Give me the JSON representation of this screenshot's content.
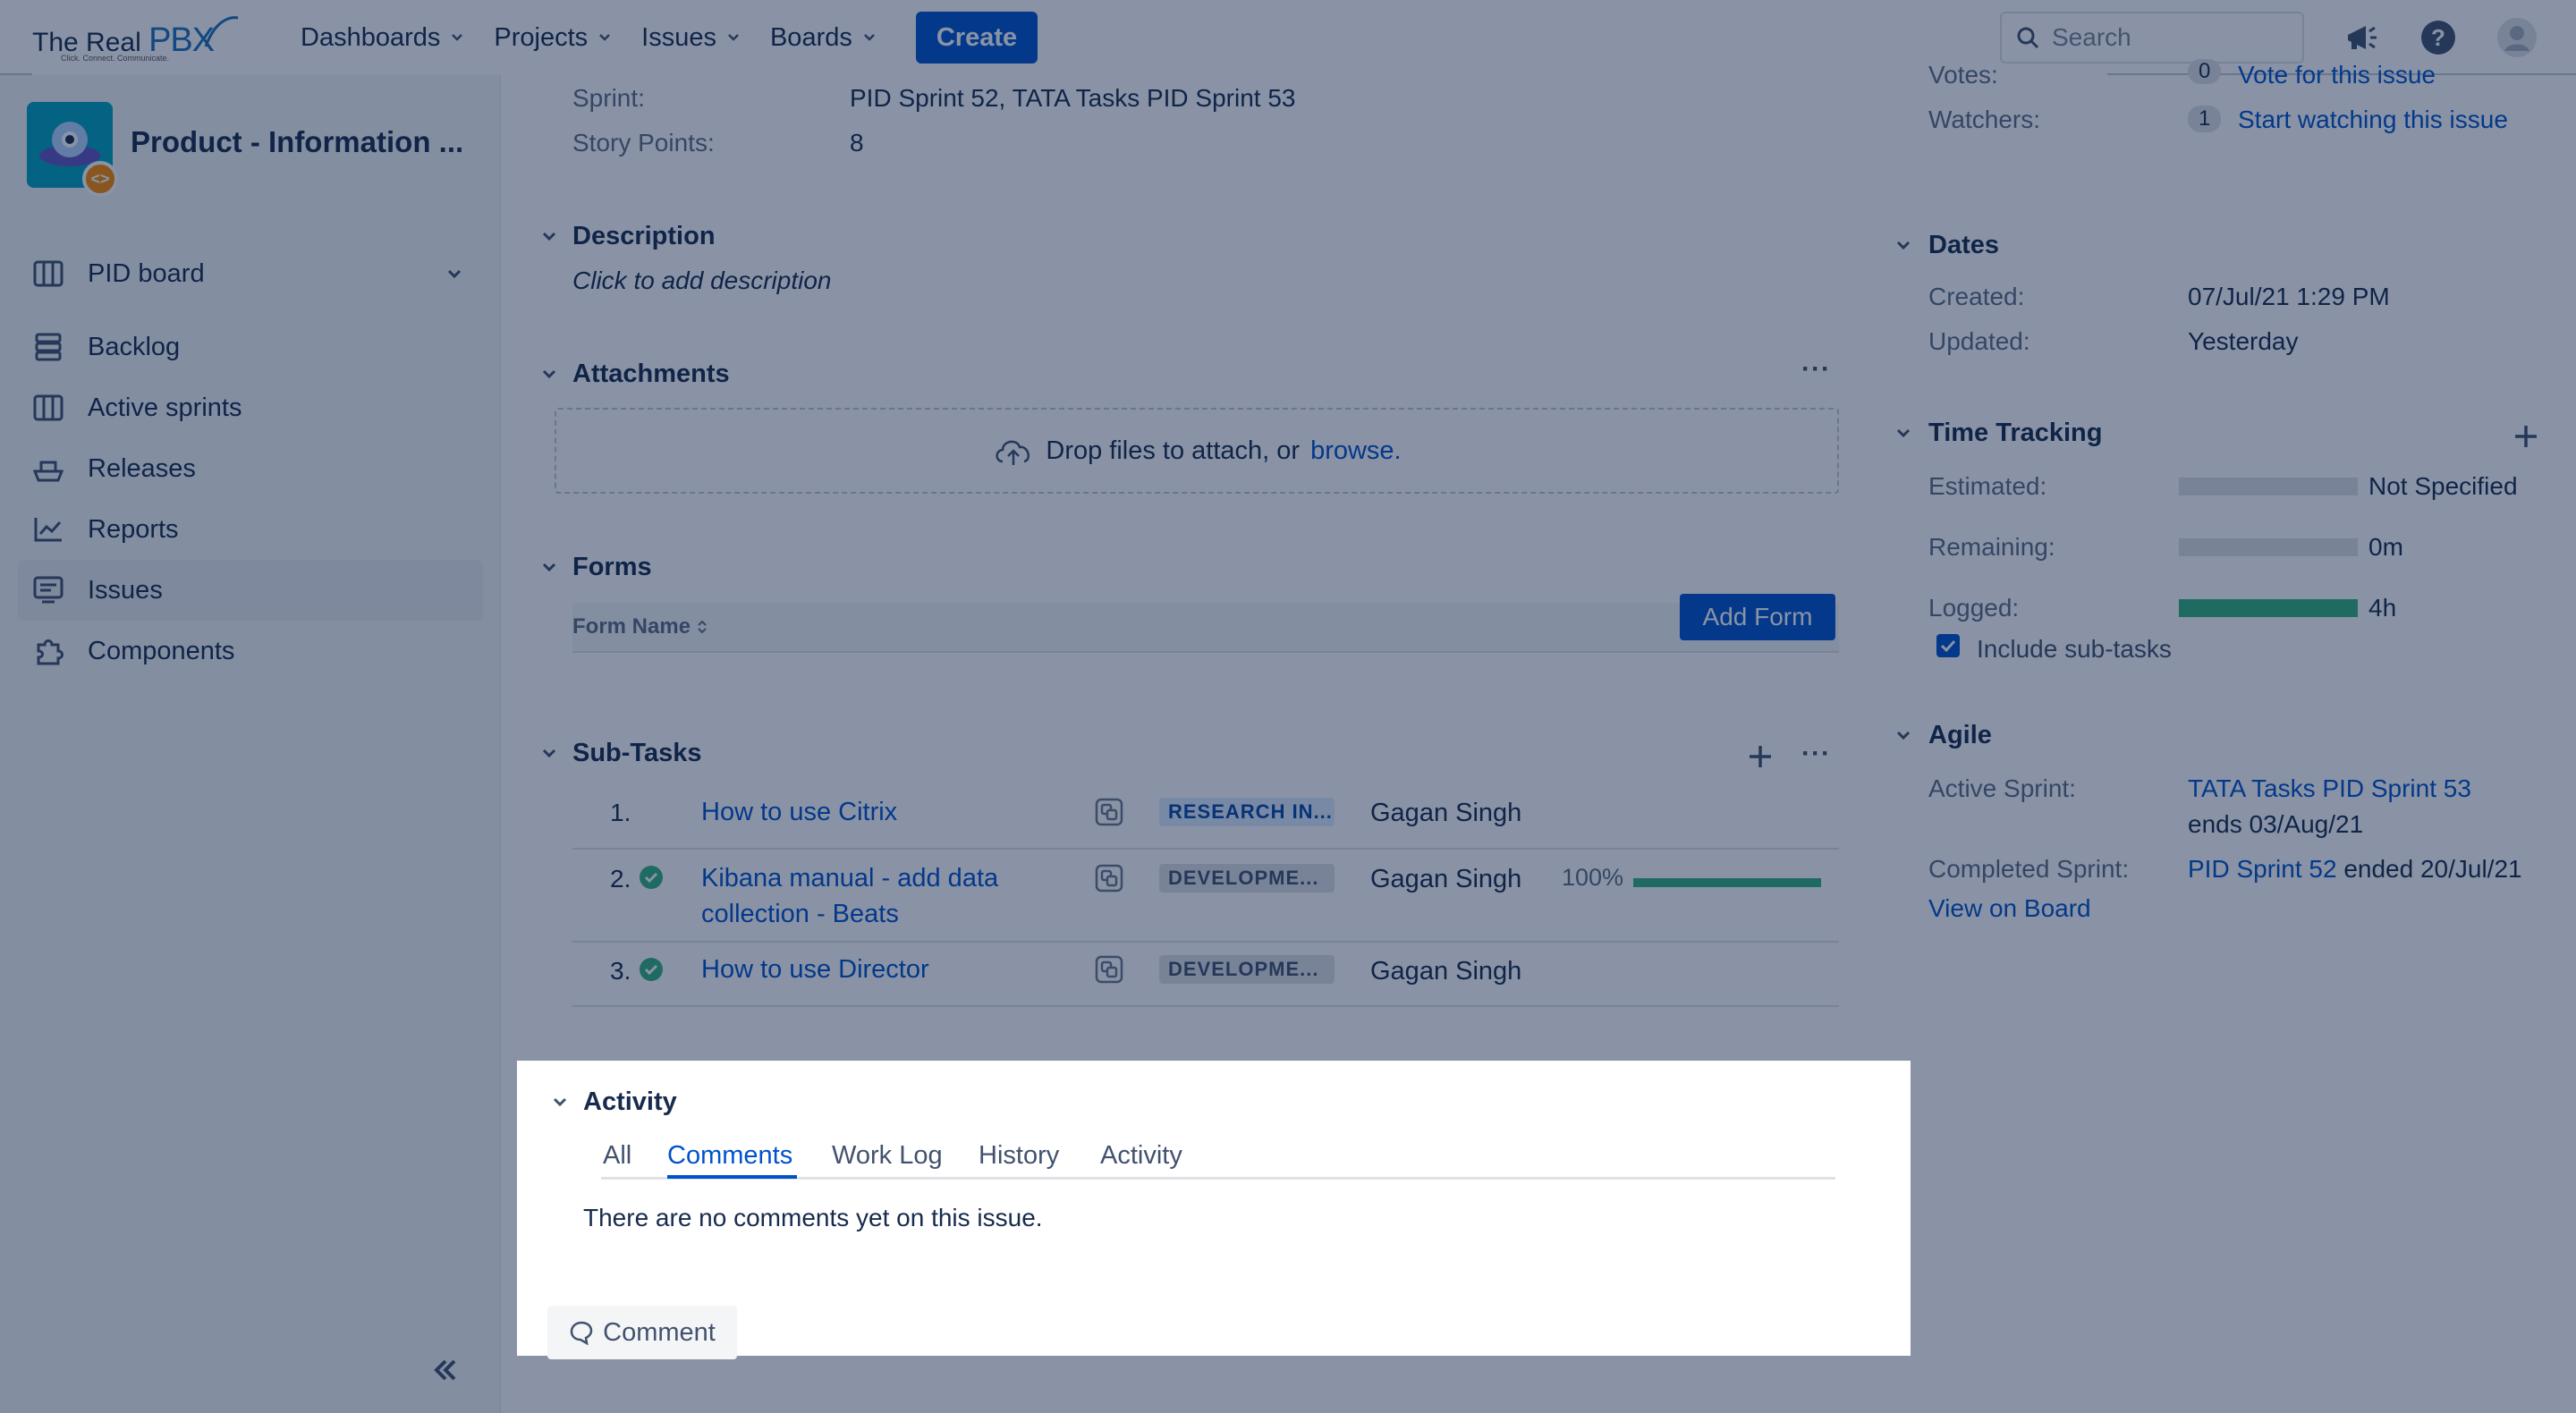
{
  "app": {
    "logo_text": "The Real",
    "logo_brand": "PBX",
    "logo_tagline": "Click. Connect. Communicate.",
    "nav": [
      {
        "label": "Dashboards"
      },
      {
        "label": "Projects"
      },
      {
        "label": "Issues"
      },
      {
        "label": "Boards"
      }
    ],
    "create_label": "Create",
    "search_placeholder": "Search"
  },
  "sidebar": {
    "project_name": "Product - Information ...",
    "items": [
      {
        "label": "PID board",
        "icon": "board-icon"
      },
      {
        "label": "Backlog",
        "icon": "backlog-icon"
      },
      {
        "label": "Active sprints",
        "icon": "sprint-icon"
      },
      {
        "label": "Releases",
        "icon": "ship-icon"
      },
      {
        "label": "Reports",
        "icon": "chart-icon"
      },
      {
        "label": "Issues",
        "icon": "issues-icon"
      },
      {
        "label": "Components",
        "icon": "puzzle-icon"
      }
    ]
  },
  "details": {
    "sprint_label": "Sprint:",
    "sprint_value": "PID Sprint 52, TATA Tasks PID Sprint 53",
    "story_points_label": "Story Points:",
    "story_points_value": "8"
  },
  "description": {
    "title": "Description",
    "placeholder": "Click to add description"
  },
  "attachments": {
    "title": "Attachments",
    "drop_text": "Drop files to attach, or",
    "browse_link": "browse."
  },
  "forms": {
    "title": "Forms",
    "column_header": "Form Name",
    "add_label": "Add Form"
  },
  "subtasks": {
    "title": "Sub-Tasks",
    "rows": [
      {
        "num": "1.",
        "done": false,
        "summary_line1": "How to use Citrix",
        "summary_line2": "",
        "status": "RESEARCH IN...",
        "assignee": "Gagan Singh",
        "progress_label": "",
        "progress": 0
      },
      {
        "num": "2.",
        "done": true,
        "summary_line1": "Kibana manual - add data",
        "summary_line2": "collection - Beats",
        "status": "DEVELOPME...",
        "assignee": "Gagan Singh",
        "progress_label": "100%",
        "progress": 1.0
      },
      {
        "num": "3.",
        "done": true,
        "summary_line1": "How to use Director",
        "summary_line2": "",
        "status": "DEVELOPME...",
        "assignee": "Gagan Singh",
        "progress_label": "",
        "progress": 0
      }
    ]
  },
  "activity": {
    "title": "Activity",
    "tabs": [
      {
        "label": "All"
      },
      {
        "label": "Comments"
      },
      {
        "label": "Work Log"
      },
      {
        "label": "History"
      },
      {
        "label": "Activity"
      }
    ],
    "active_tab": "Comments",
    "empty_text": "There are no comments yet on this issue.",
    "comment_button": "Comment"
  },
  "people": {
    "votes_label": "Votes:",
    "votes_count": "0",
    "vote_link": "Vote for this issue",
    "watchers_label": "Watchers:",
    "watchers_count": "1",
    "watch_link": "Start watching this issue"
  },
  "dates": {
    "title": "Dates",
    "created_label": "Created:",
    "created_value": "07/Jul/21 1:29 PM",
    "updated_label": "Updated:",
    "updated_value": "Yesterday"
  },
  "time_tracking": {
    "title": "Time Tracking",
    "estimated_label": "Estimated:",
    "estimated_value": "Not Specified",
    "estimated_fill": 0,
    "remaining_label": "Remaining:",
    "remaining_value": "0m",
    "remaining_fill": 0,
    "logged_label": "Logged:",
    "logged_value": "4h",
    "logged_fill": 1.0,
    "include_subtasks_label": "Include sub-tasks",
    "include_subtasks_checked": true
  },
  "agile": {
    "title": "Agile",
    "active_sprint_label": "Active Sprint:",
    "active_sprint_link": "TATA Tasks PID Sprint 53",
    "active_sprint_ends": "ends 03/Aug/21",
    "completed_sprint_label": "Completed Sprint:",
    "completed_sprint_link": "PID Sprint 52",
    "completed_sprint_ended": "ended 20/Jul/21",
    "view_on_board": "View on Board"
  },
  "colors": {
    "brand": "#0052cc",
    "success": "#36b37e",
    "overlay": "#091e42"
  }
}
